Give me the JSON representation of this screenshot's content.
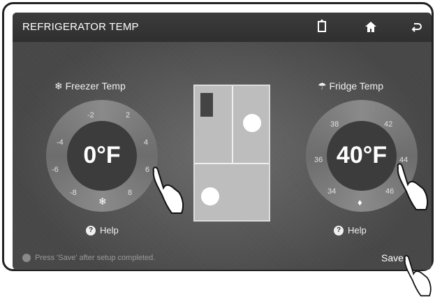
{
  "header": {
    "title": "REFRIGERATOR TEMP"
  },
  "icons": {
    "smarthome": "tablet-icon",
    "home": "home-icon",
    "back": "back-icon"
  },
  "freezer": {
    "label": "Freezer Temp",
    "value": "0°F",
    "scale": [
      "-2",
      "2",
      "-4",
      "4",
      "-6",
      "6",
      "-8",
      "8"
    ],
    "help": "Help"
  },
  "fridge": {
    "label": "Fridge Temp",
    "value": "40°F",
    "scale": [
      "38",
      "42",
      "36",
      "44",
      "34",
      "46"
    ],
    "help": "Help"
  },
  "notice": "Press 'Save' after setup completed.",
  "save_label": "Save",
  "colors": {
    "screen": "#4a4a4a",
    "accent": "#ffffff",
    "dial": "#7a7a7a"
  }
}
